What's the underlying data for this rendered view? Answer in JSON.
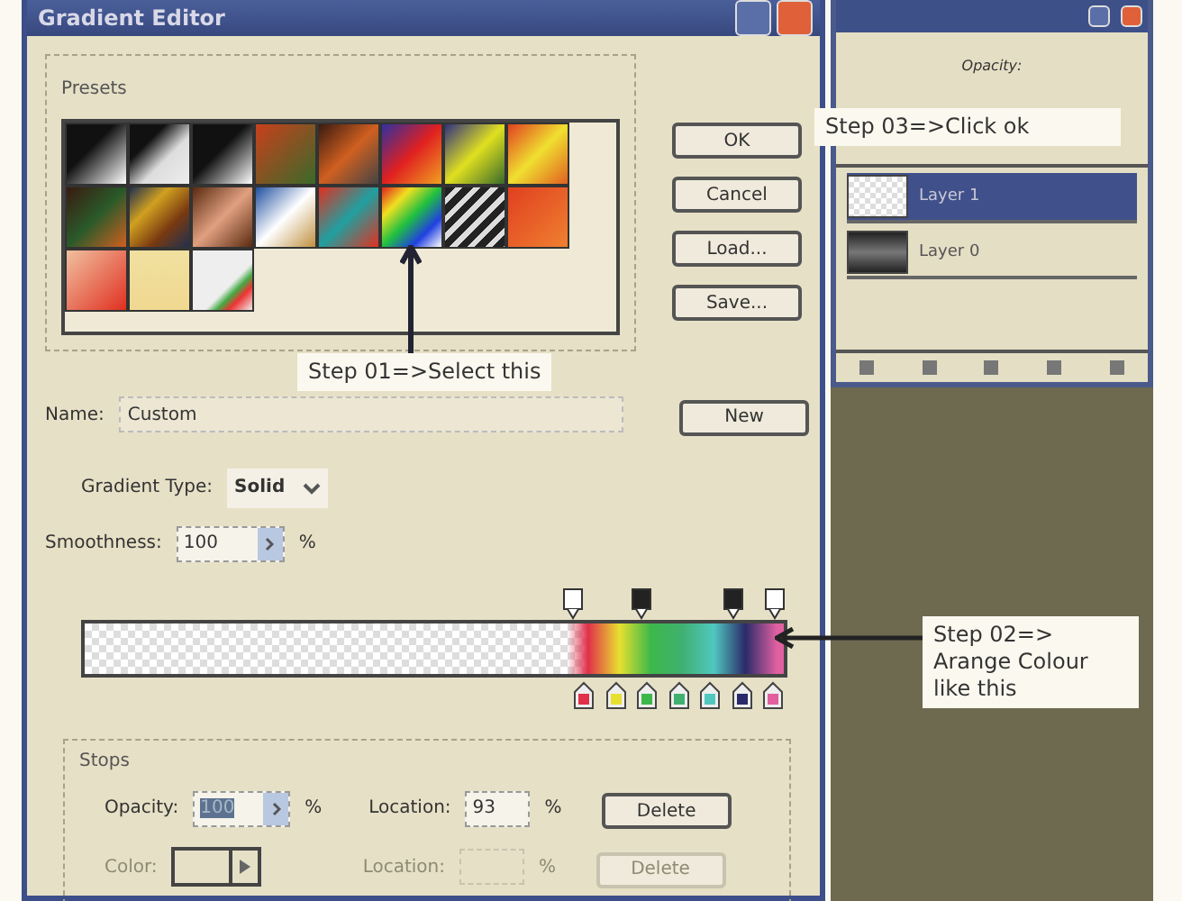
{
  "window": {
    "title": "Gradient Editor"
  },
  "presets": {
    "label": "Presets"
  },
  "buttons": [
    {
      "label": "OK"
    },
    {
      "label": "Cancel"
    },
    {
      "label": "Load..."
    },
    {
      "label": "Save..."
    }
  ],
  "name_row": {
    "label": "Name:",
    "value": "Custom",
    "button": "New"
  },
  "gradient_type": {
    "label": "Gradient Type:",
    "value": "Solid"
  },
  "smoothness": {
    "label": "Smoothness:",
    "value": "100",
    "unit": "%"
  },
  "opacity_stops": [
    {
      "selected": false
    },
    {
      "selected": true
    },
    {
      "selected": true
    },
    {
      "selected": false
    }
  ],
  "color_stops": [
    {
      "color": "#e0304a"
    },
    {
      "color": "#e8e030"
    },
    {
      "color": "#3cb84a"
    },
    {
      "color": "#40b070"
    },
    {
      "color": "#50c8c0"
    },
    {
      "color": "#2a2a6a"
    },
    {
      "color": "#e060a0"
    }
  ],
  "stops": {
    "label": "Stops",
    "rows": [
      {
        "label": "Opacity:",
        "value": "100",
        "unit": "%",
        "location_label": "Location:",
        "location": "93",
        "location_unit": "%",
        "button": "Delete",
        "disabled": false
      },
      {
        "label": "Color:",
        "value": "",
        "location_label": "Location:",
        "location": "",
        "location_unit": "%",
        "button": "Delete",
        "disabled": true
      }
    ]
  },
  "layers_panel": {
    "opacity_label": "Opacity:",
    "layers": [
      {
        "name": "Layer 1",
        "selected": true
      },
      {
        "name": "Layer 0",
        "selected": false
      }
    ]
  },
  "annotations": [
    {
      "text": "Step 01=>Select this"
    },
    {
      "text": "Step 02=>\nArange Colour\nlike this"
    },
    {
      "text": "Step 03=>Click ok"
    }
  ]
}
